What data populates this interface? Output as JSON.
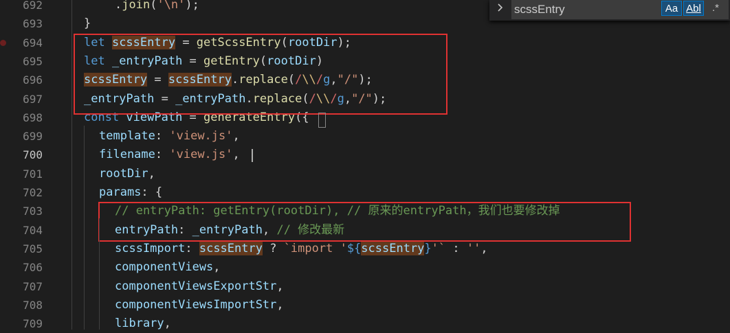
{
  "find": {
    "query": "scssEntry",
    "case_label": "Aa",
    "word_label": "Abl",
    "regex_label": ".*"
  },
  "lines": [
    {
      "n": "692",
      "tokens": [
        {
          "t": ".",
          "c": "punc"
        },
        {
          "t": "join",
          "c": "fn"
        },
        {
          "t": "(",
          "c": "punc"
        },
        {
          "t": "'\\n'",
          "c": "str"
        },
        {
          "t": ");",
          "c": "punc"
        }
      ]
    },
    {
      "n": "693",
      "tokens": [
        {
          "t": "}",
          "c": "punc"
        }
      ]
    },
    {
      "n": "694",
      "tokens": [
        {
          "t": "let ",
          "c": "kw"
        },
        {
          "t": "scssEntry",
          "c": "var hl"
        },
        {
          "t": " = ",
          "c": "punc"
        },
        {
          "t": "getScssEntry",
          "c": "fn"
        },
        {
          "t": "(",
          "c": "punc"
        },
        {
          "t": "rootDir",
          "c": "var"
        },
        {
          "t": ");",
          "c": "punc"
        }
      ]
    },
    {
      "n": "695",
      "tokens": [
        {
          "t": "let ",
          "c": "kw"
        },
        {
          "t": "_entryPath",
          "c": "var"
        },
        {
          "t": " = ",
          "c": "punc"
        },
        {
          "t": "getEntry",
          "c": "fn"
        },
        {
          "t": "(",
          "c": "punc"
        },
        {
          "t": "rootDir",
          "c": "var"
        },
        {
          "t": ")",
          "c": "punc"
        }
      ]
    },
    {
      "n": "696",
      "tokens": [
        {
          "t": "scssEntry",
          "c": "var hl"
        },
        {
          "t": " = ",
          "c": "punc"
        },
        {
          "t": "scssEntry",
          "c": "var hl"
        },
        {
          "t": ".",
          "c": "punc"
        },
        {
          "t": "replace",
          "c": "fn"
        },
        {
          "t": "(",
          "c": "punc"
        },
        {
          "t": "/",
          "c": "rx"
        },
        {
          "t": "\\\\",
          "c": "rxe"
        },
        {
          "t": "/",
          "c": "rx"
        },
        {
          "t": "g",
          "c": "rxf"
        },
        {
          "t": ",",
          "c": "punc"
        },
        {
          "t": "\"/\"",
          "c": "str"
        },
        {
          "t": ");",
          "c": "punc"
        }
      ]
    },
    {
      "n": "697",
      "tokens": [
        {
          "t": "_entryPath",
          "c": "var"
        },
        {
          "t": " = ",
          "c": "punc"
        },
        {
          "t": "_entryPath",
          "c": "var"
        },
        {
          "t": ".",
          "c": "punc"
        },
        {
          "t": "replace",
          "c": "fn"
        },
        {
          "t": "(",
          "c": "punc"
        },
        {
          "t": "/",
          "c": "rx"
        },
        {
          "t": "\\\\",
          "c": "rxe"
        },
        {
          "t": "/",
          "c": "rx"
        },
        {
          "t": "g",
          "c": "rxf"
        },
        {
          "t": ",",
          "c": "punc"
        },
        {
          "t": "\"/\"",
          "c": "str"
        },
        {
          "t": ");",
          "c": "punc"
        }
      ]
    },
    {
      "n": "698",
      "tokens": [
        {
          "t": "const ",
          "c": "kw"
        },
        {
          "t": "viewPath",
          "c": "var"
        },
        {
          "t": " = ",
          "c": "punc"
        },
        {
          "t": "generateEntry",
          "c": "fn"
        },
        {
          "t": "({",
          "c": "punc"
        }
      ]
    },
    {
      "n": "699",
      "tokens": [
        {
          "t": "template",
          "c": "var"
        },
        {
          "t": ": ",
          "c": "punc"
        },
        {
          "t": "'view.js'",
          "c": "str"
        },
        {
          "t": ",",
          "c": "punc"
        }
      ]
    },
    {
      "n": "700",
      "tokens": [
        {
          "t": "filename",
          "c": "var"
        },
        {
          "t": ": ",
          "c": "punc"
        },
        {
          "t": "'view.js'",
          "c": "str"
        },
        {
          "t": ",",
          "c": "punc"
        }
      ]
    },
    {
      "n": "701",
      "tokens": [
        {
          "t": "rootDir",
          "c": "var"
        },
        {
          "t": ",",
          "c": "punc"
        }
      ]
    },
    {
      "n": "702",
      "tokens": [
        {
          "t": "params",
          "c": "var"
        },
        {
          "t": ": {",
          "c": "punc"
        }
      ]
    },
    {
      "n": "703",
      "tokens": [
        {
          "t": "// entryPath: getEntry(rootDir), // 原来的entryPath，我们也要修改掉",
          "c": "cm"
        }
      ]
    },
    {
      "n": "704",
      "tokens": [
        {
          "t": "entryPath",
          "c": "var"
        },
        {
          "t": ": ",
          "c": "punc"
        },
        {
          "t": "_entryPath",
          "c": "var"
        },
        {
          "t": ", ",
          "c": "punc"
        },
        {
          "t": "// 修改最新",
          "c": "cm"
        }
      ]
    },
    {
      "n": "705",
      "tokens": [
        {
          "t": "scssImport",
          "c": "var"
        },
        {
          "t": ": ",
          "c": "punc"
        },
        {
          "t": "scssEntry",
          "c": "var hl"
        },
        {
          "t": " ? ",
          "c": "punc"
        },
        {
          "t": "`import '",
          "c": "str"
        },
        {
          "t": "${",
          "c": "kw"
        },
        {
          "t": "scssEntry",
          "c": "var hl"
        },
        {
          "t": "}",
          "c": "kw"
        },
        {
          "t": "'`",
          "c": "str"
        },
        {
          "t": " : ",
          "c": "punc"
        },
        {
          "t": "''",
          "c": "str"
        },
        {
          "t": ",",
          "c": "punc"
        }
      ]
    },
    {
      "n": "706",
      "tokens": [
        {
          "t": "componentViews",
          "c": "var"
        },
        {
          "t": ",",
          "c": "punc"
        }
      ]
    },
    {
      "n": "707",
      "tokens": [
        {
          "t": "componentViewsExportStr",
          "c": "var"
        },
        {
          "t": ",",
          "c": "punc"
        }
      ]
    },
    {
      "n": "708",
      "tokens": [
        {
          "t": "componentViewsImportStr",
          "c": "var"
        },
        {
          "t": ",",
          "c": "punc"
        }
      ]
    },
    {
      "n": "709",
      "tokens": [
        {
          "t": "library",
          "c": "var"
        },
        {
          "t": ",",
          "c": "punc"
        }
      ]
    }
  ]
}
